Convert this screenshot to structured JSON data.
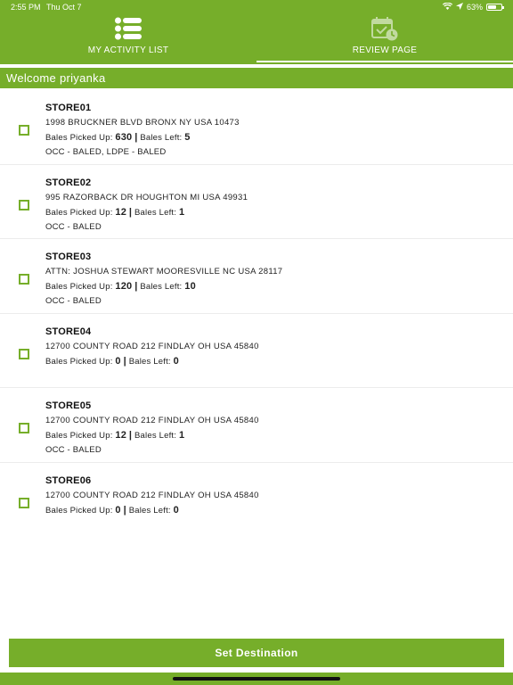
{
  "status_bar": {
    "time": "2:55 PM",
    "date": "Thu Oct 7",
    "battery": "63%",
    "battery_level": 0.63
  },
  "tabs": [
    {
      "label": "MY ACTIVITY LIST",
      "icon": "list-icon"
    },
    {
      "label": "REVIEW PAGE",
      "icon": "calendar-check-icon"
    }
  ],
  "welcome": "Welcome priyanka",
  "labels": {
    "picked": "Bales Picked Up:",
    "left": "Bales Left:",
    "separator": "|"
  },
  "stores": [
    {
      "name": "STORE01",
      "address": "1998 BRUCKNER BLVD BRONX NY USA 10473",
      "picked": "630",
      "left": "5",
      "material": "OCC - BALED, LDPE - BALED"
    },
    {
      "name": "STORE02",
      "address": "995 RAZORBACK DR HOUGHTON MI USA 49931",
      "picked": "12",
      "left": "1",
      "material": "OCC - BALED"
    },
    {
      "name": "STORE03",
      "address": "ATTN: JOSHUA STEWART MOORESVILLE NC USA 28117",
      "picked": "120",
      "left": "10",
      "material": "OCC - BALED"
    },
    {
      "name": "STORE04",
      "address": "12700 COUNTY ROAD 212 FINDLAY OH USA 45840",
      "picked": "0",
      "left": "0",
      "material": ""
    },
    {
      "name": "STORE05",
      "address": "12700 COUNTY ROAD 212 FINDLAY OH USA 45840",
      "picked": "12",
      "left": "1",
      "material": "OCC - BALED"
    },
    {
      "name": "STORE06",
      "address": "12700 COUNTY ROAD 212 FINDLAY OH USA 45840",
      "picked": "0",
      "left": "0",
      "material": ""
    }
  ],
  "button": "Set Destination",
  "colors": {
    "accent": "#76ae2a"
  }
}
